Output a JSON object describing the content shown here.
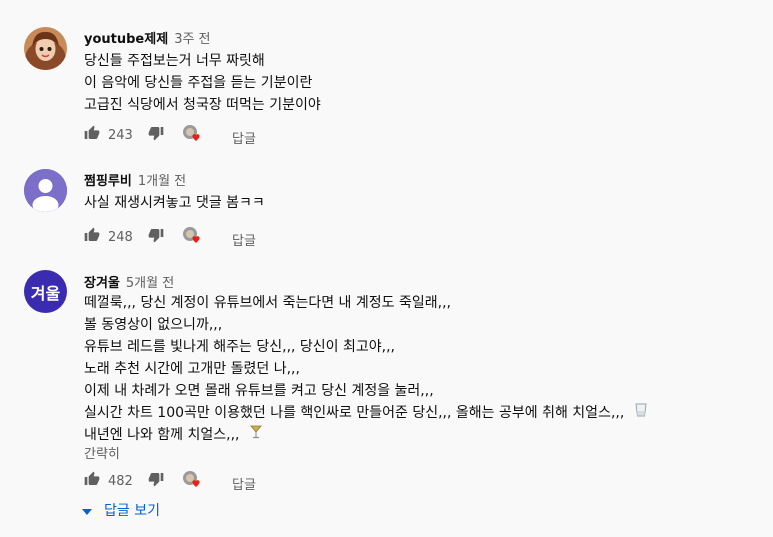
{
  "comments": [
    {
      "author": "youtube제제",
      "time": "3주 전",
      "lines": [
        "당신들 주접보는거 너무 짜릿해",
        "이 음악에 당신들 주접을 듣는 기분이란",
        "고급진 식당에서 청국장 떠먹는 기분이야"
      ],
      "likes": "243",
      "reply_label": "답글"
    },
    {
      "author": "쩜핑루비",
      "time": "1개월 전",
      "lines": [
        "사실 재생시켜놓고 댓글 봄ㅋㅋ"
      ],
      "likes": "248",
      "reply_label": "답글"
    },
    {
      "author": "장겨울",
      "time": "5개월 전",
      "avatar_text": "겨울",
      "lines": [
        "떼껄룩,,, 당신 계정이 유튜브에서 죽는다면 내 계정도 죽일래,,,",
        "볼 동영상이 없으니까,,,",
        "유튜브 레드를 빛나게 해주는 당신,,, 당신이 최고야,,,",
        "노래 추천 시간에 고개만 돌렸던 나,,,",
        "이제 내 차례가 오면 몰래 유튜브를 켜고 당신 계정을 눌러,,,",
        "실시간 차트 100곡만 이용했던 나를 핵인싸로 만들어준 당신,,, 올해는 공부에 취해 치얼스,,,",
        "내년엔 나와 함께 치얼스,,,"
      ],
      "read_more": "간략히",
      "likes": "482",
      "reply_label": "답글",
      "view_replies": "답글 보기"
    }
  ],
  "colors": {
    "background": "#f9f9f9",
    "secondary_text": "#606060",
    "link_blue": "#065fd4",
    "avatar_purple": "#7b6fc9",
    "avatar_indigo": "#3b2bb0",
    "heart_red": "#e62117"
  },
  "icons": [
    "thumbs-up-icon",
    "thumbs-down-icon",
    "creator-heart-icon",
    "caret-down-icon",
    "glass-emoji-icon",
    "cocktail-emoji-icon"
  ]
}
